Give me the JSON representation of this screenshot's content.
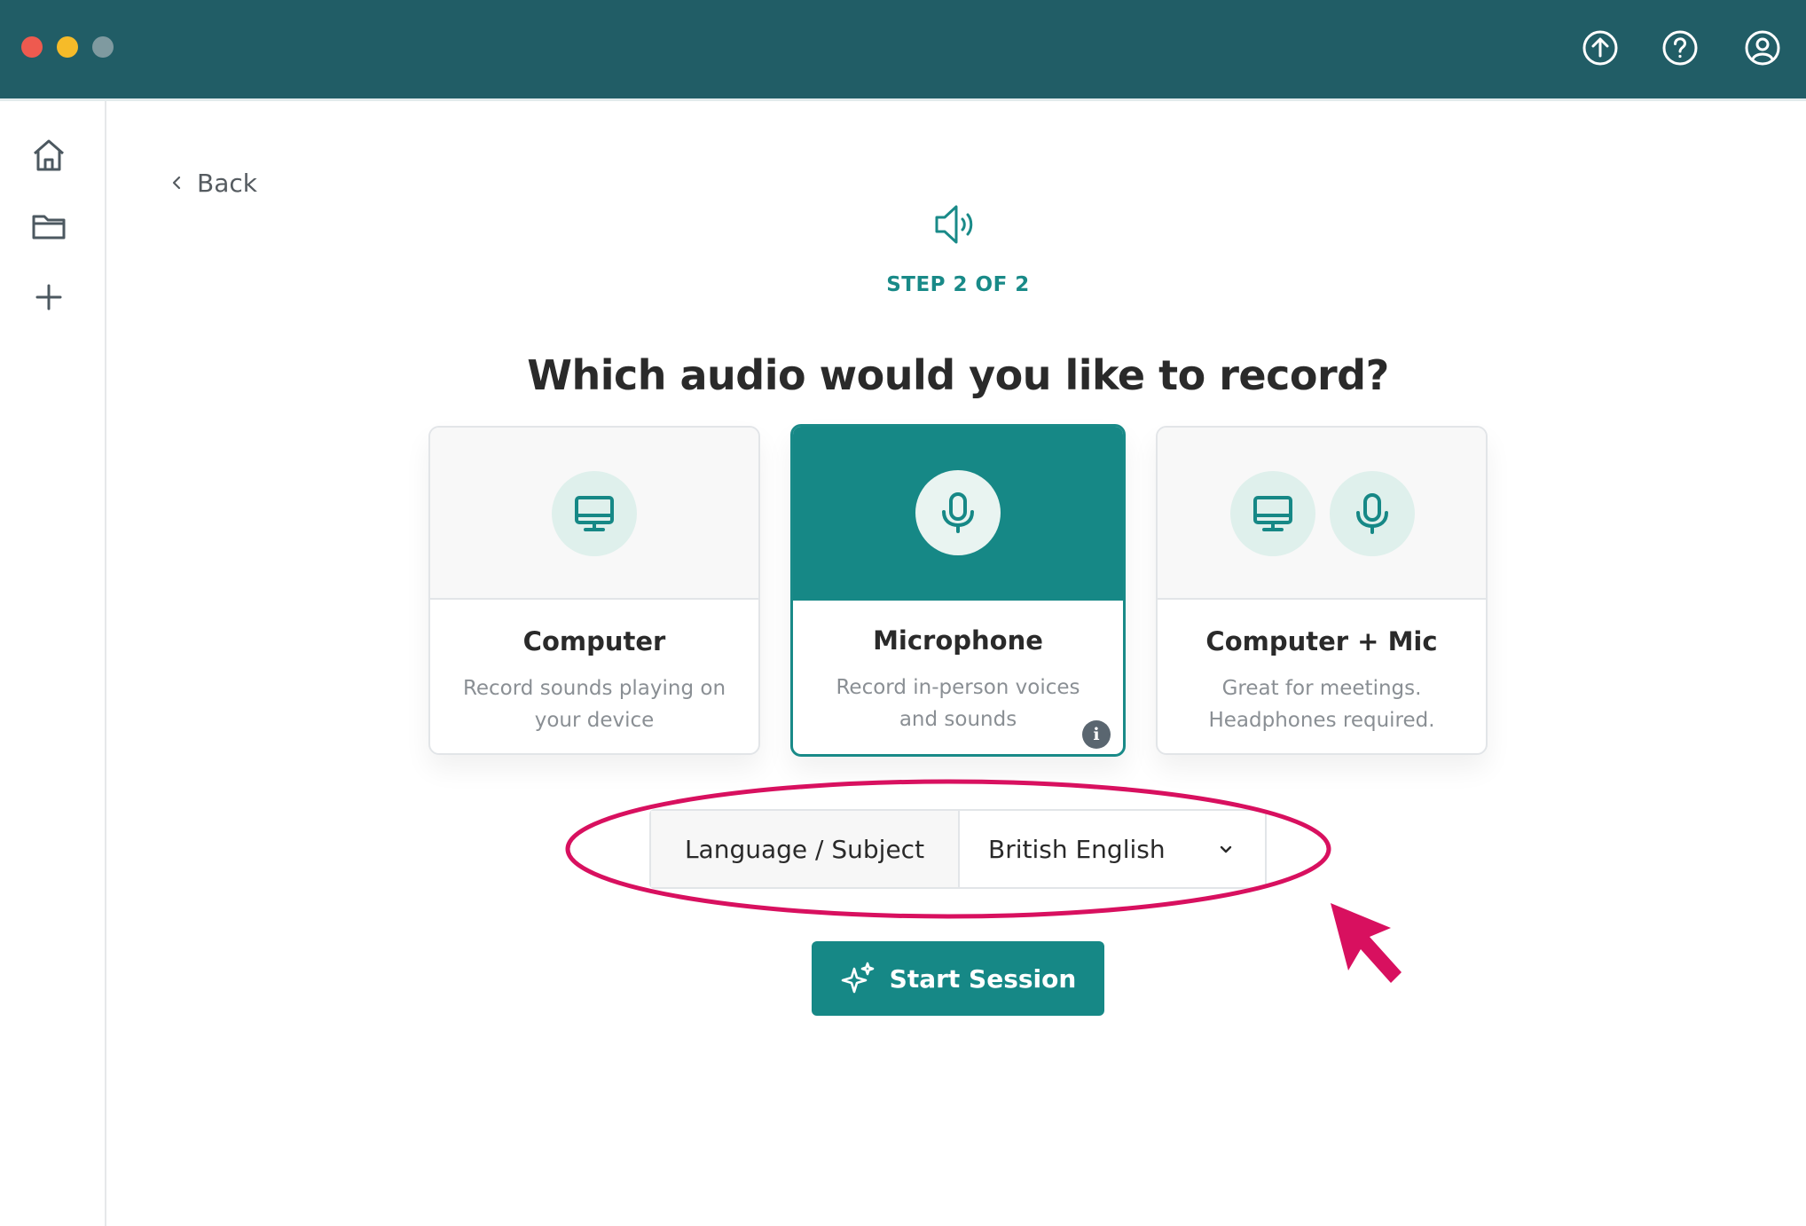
{
  "nav": {
    "back_label": "Back"
  },
  "header": {
    "step": "STEP 2 OF 2",
    "title": "Which audio would you like to record?"
  },
  "options": [
    {
      "id": "computer",
      "title": "Computer",
      "description": "Record sounds playing on your device",
      "icon": "monitor-icon",
      "selected": false
    },
    {
      "id": "microphone",
      "title": "Microphone",
      "description": "Record in-person voices and sounds",
      "icon": "microphone-icon",
      "selected": true
    },
    {
      "id": "computer-mic",
      "title": "Computer + Mic",
      "description": "Great for meetings. Headphones required.",
      "icon": "monitor-and-microphone-icons",
      "selected": false
    }
  ],
  "language": {
    "label": "Language / Subject",
    "value": "British English"
  },
  "actions": {
    "start_label": "Start Session"
  },
  "info_badge": "i",
  "colors": {
    "topbar": "#215d66",
    "accent": "#168886",
    "annotation": "#d8105f"
  }
}
